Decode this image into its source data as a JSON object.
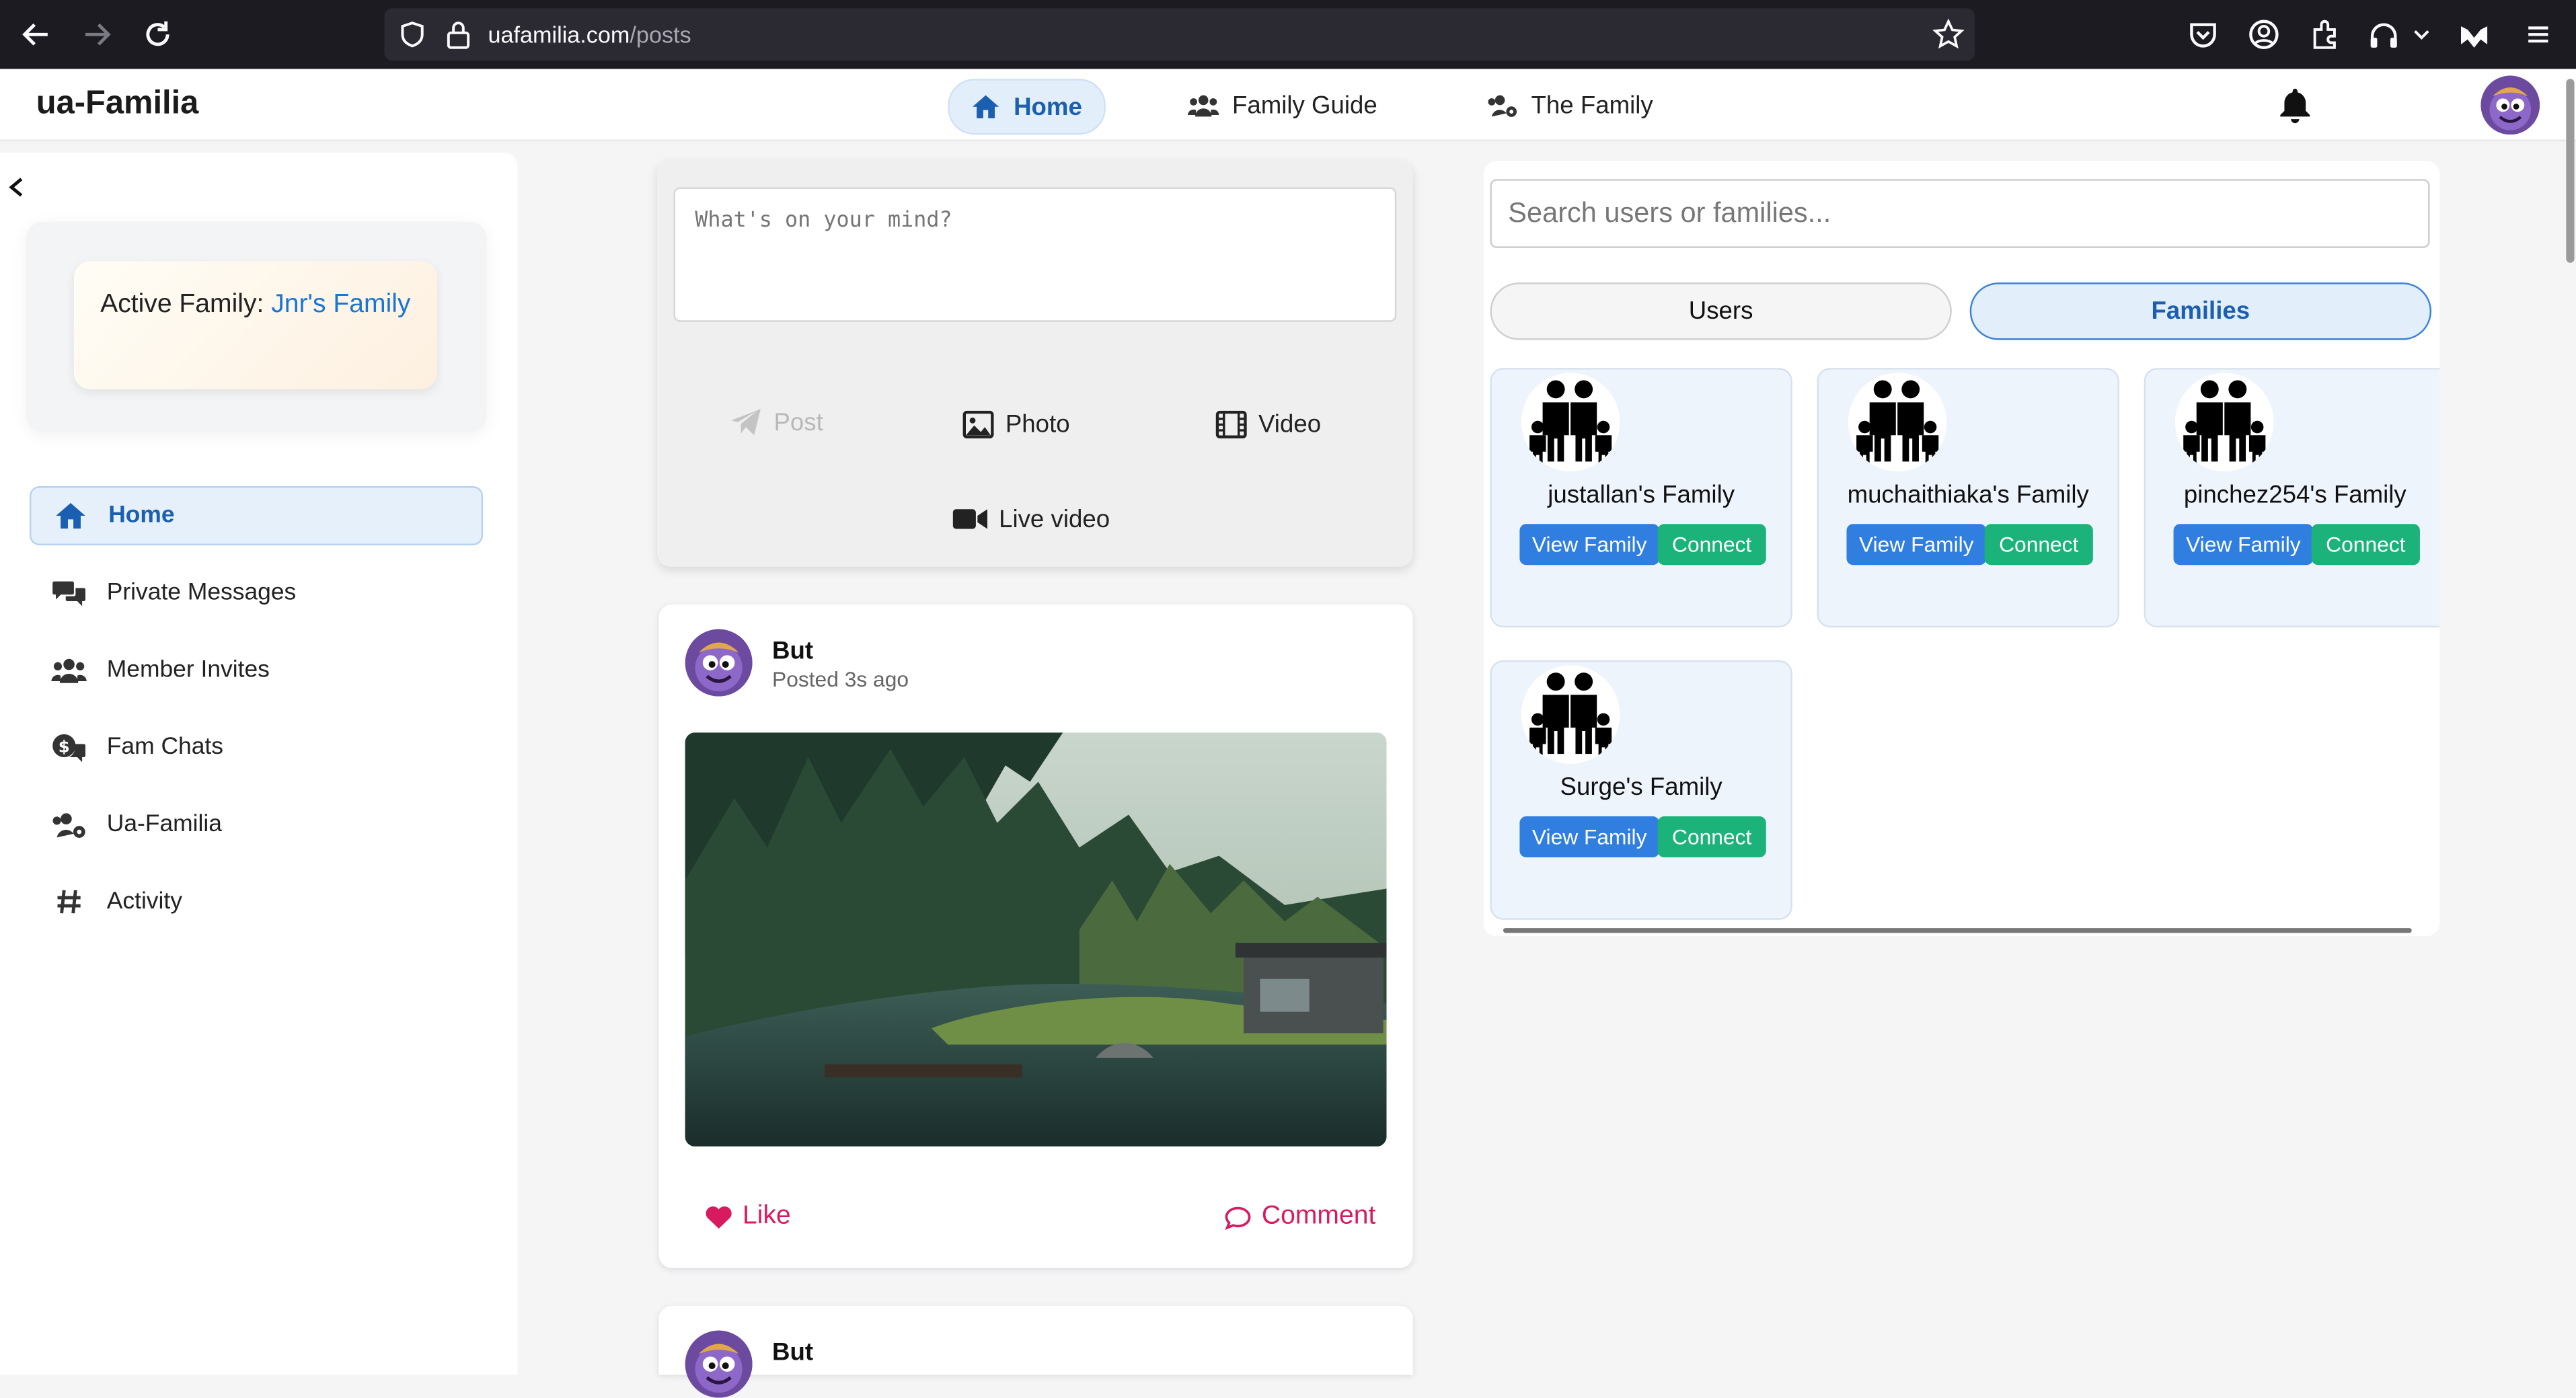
{
  "browser": {
    "url_domain": "uafamilia.com",
    "url_path": "/posts"
  },
  "header": {
    "brand": "ua-Familia",
    "nav": [
      {
        "label": "Home"
      },
      {
        "label": "Family Guide"
      },
      {
        "label": "The Family"
      }
    ]
  },
  "sidebar": {
    "active_family_label": "Active Family:",
    "active_family_name": "Jnr's Family",
    "items": [
      {
        "label": "Home",
        "icon": "home-icon"
      },
      {
        "label": "Private Messages",
        "icon": "chat-bubbles-icon"
      },
      {
        "label": "Member Invites",
        "icon": "users-icon"
      },
      {
        "label": "Fam Chats",
        "icon": "dollar-chat-icon"
      },
      {
        "label": "Ua-Familia",
        "icon": "users-gear-icon"
      },
      {
        "label": "Activity",
        "icon": "hashtag-icon"
      }
    ]
  },
  "composer": {
    "placeholder": "What's on your mind?",
    "post_label": "Post",
    "photo_label": "Photo",
    "video_label": "Video",
    "live_label": "Live video"
  },
  "posts": [
    {
      "author": "But",
      "time": "Posted 3s ago",
      "like_label": "Like",
      "comment_label": "Comment"
    },
    {
      "author": "But"
    }
  ],
  "right_panel": {
    "search_placeholder": "Search users or families...",
    "tab_users": "Users",
    "tab_families": "Families",
    "families": [
      {
        "name": "justallan's Family",
        "view_label": "View Family",
        "connect_label": "Connect"
      },
      {
        "name": "muchaithiaka's Family",
        "view_label": "View Family",
        "connect_label": "Connect"
      },
      {
        "name": "pinchez254's Family",
        "view_label": "View Family",
        "connect_label": "Connect"
      },
      {
        "name": "Surge's Family",
        "view_label": "View Family",
        "connect_label": "Connect"
      }
    ]
  },
  "colors": {
    "accent": "#1b5fb0",
    "view_button": "#2f7ee0",
    "connect_button": "#1bb37a",
    "like": "#d81b60"
  }
}
